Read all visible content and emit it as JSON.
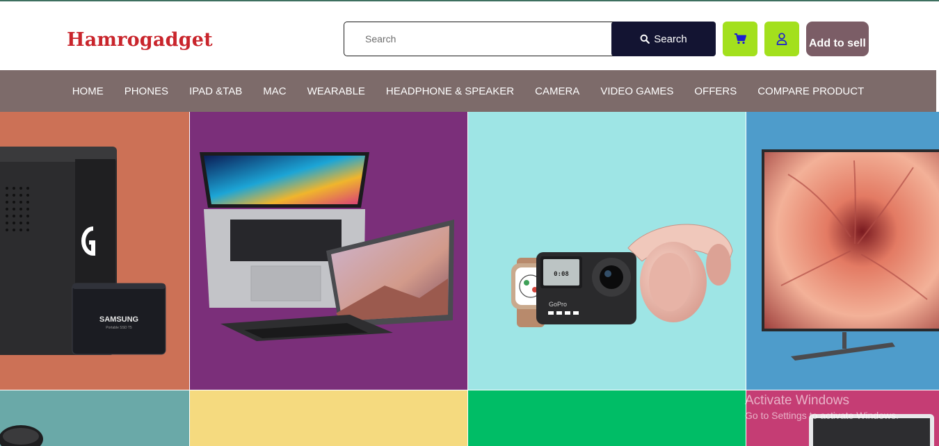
{
  "brand": {
    "name": "Hamrogadget",
    "color": "#c9252c"
  },
  "search": {
    "placeholder": "Search",
    "value": "",
    "button_label": "Search"
  },
  "actions": {
    "cart_icon": "cart-icon",
    "user_icon": "user-icon",
    "sell_label": "Add to sell",
    "accent": "#a3e01d",
    "sell_color": "#7b5d66"
  },
  "nav": {
    "background": "#7d6b6a",
    "items": [
      {
        "label": "HOME"
      },
      {
        "label": "PHONES"
      },
      {
        "label": "IPAD &TAB"
      },
      {
        "label": "MAC"
      },
      {
        "label": "WEARABLE"
      },
      {
        "label": "HEADPHONE & SPEAKER"
      },
      {
        "label": "CAMERA"
      },
      {
        "label": "VIDEO GAMES"
      },
      {
        "label": "OFFERS"
      },
      {
        "label": "COMPARE PRODUCT"
      }
    ]
  },
  "tiles": [
    {
      "name": "storage-tile",
      "color": "#cc7156",
      "product_text": "SAMSUNG",
      "product_subtext": "Portable SSD T5"
    },
    {
      "name": "laptop-tile",
      "color": "#7b2f7a"
    },
    {
      "name": "wearables-tile",
      "color": "#9ee5e5",
      "product_text": "GoPro",
      "camera_readout": "0:08"
    },
    {
      "name": "tv-tile",
      "color": "#4e9ccb"
    }
  ],
  "bottom_tiles": [
    {
      "color": "#6aa9a8"
    },
    {
      "color": "#f5da7f"
    },
    {
      "color": "#00bd66"
    },
    {
      "color": "#c53d74"
    }
  ],
  "watermark": {
    "title": "Activate Windows",
    "subtitle": "Go to Settings to activate Windows."
  }
}
